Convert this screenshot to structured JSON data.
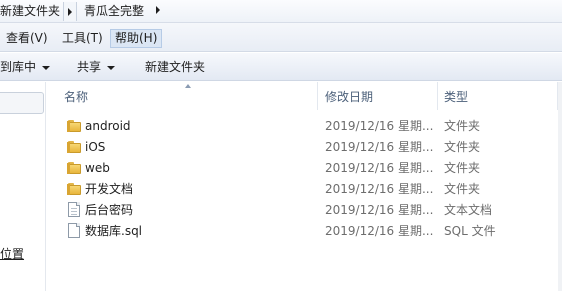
{
  "address_bar": {
    "crumbs": [
      "新建文件夹",
      "青瓜全完整"
    ]
  },
  "menu": {
    "items": [
      "查看(V)",
      "工具(T)",
      "帮助(H)"
    ]
  },
  "toolbar": {
    "include_in_library": "到库中",
    "share": "共享",
    "new_folder": "新建文件夹"
  },
  "nav": {
    "location_link": "位置"
  },
  "columns": {
    "name": "名称",
    "modified": "修改日期",
    "type": "类型"
  },
  "files": [
    {
      "name": "android",
      "modified": "2019/12/16 星期...",
      "type": "文件夹",
      "icon": "folder-icon"
    },
    {
      "name": "iOS",
      "modified": "2019/12/16 星期...",
      "type": "文件夹",
      "icon": "folder-icon"
    },
    {
      "name": "web",
      "modified": "2019/12/16 星期...",
      "type": "文件夹",
      "icon": "folder-icon"
    },
    {
      "name": "开发文档",
      "modified": "2019/12/16 星期...",
      "type": "文件夹",
      "icon": "folder-icon"
    },
    {
      "name": "后台密码",
      "modified": "2019/12/16 星期...",
      "type": "文本文档",
      "icon": "text-file-icon"
    },
    {
      "name": "数据库.sql",
      "modified": "2019/12/16 星期...",
      "type": "SQL 文件",
      "icon": "sql-file-icon"
    }
  ]
}
